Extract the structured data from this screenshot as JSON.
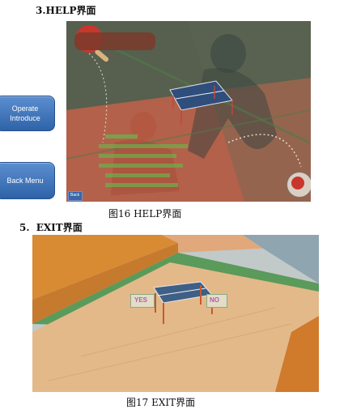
{
  "help_section": {
    "heading": "3.HELP界面",
    "caption": "图16    HELP界面",
    "buttons": {
      "operate_line1": "Operate",
      "operate_line2": "Introduce",
      "back_menu": "Back Menu"
    },
    "screen": {
      "back_label": "Back"
    }
  },
  "exit_section": {
    "heading_num": "5.",
    "heading_text": "EXIT界面",
    "caption": "图17    EXIT界面",
    "screen": {
      "yes_label": "YES",
      "no_label": "NO"
    }
  }
}
